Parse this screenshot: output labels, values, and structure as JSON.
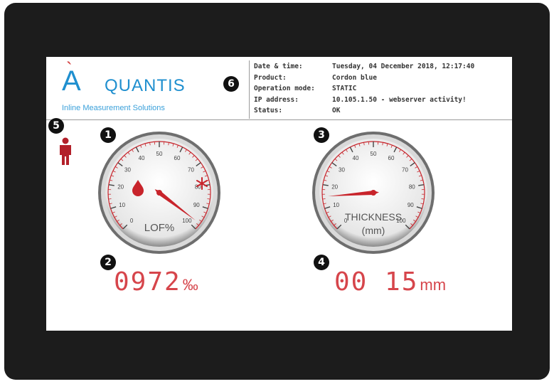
{
  "brand": {
    "logo_text": "AQUANTIS",
    "tagline": "Inline Measurement Solutions",
    "colors": {
      "blue": "#1f8fcf",
      "red": "#d23a3a"
    }
  },
  "info": {
    "rows": [
      {
        "label": "Date & time:",
        "value": "Tuesday, 04 December 2018, 12:17:40"
      },
      {
        "label": "Product:",
        "value": "Cordon blue"
      },
      {
        "label": "Operation mode:",
        "value": "STATIC"
      },
      {
        "label": "IP address:",
        "value": "10.105.1.50 - webserver activity!"
      },
      {
        "label": "Status:",
        "value": "OK"
      }
    ]
  },
  "badges": [
    "1",
    "2",
    "3",
    "4",
    "5",
    "6"
  ],
  "gauge_lof": {
    "label": "LOF%",
    "ticks": [
      "0",
      "10",
      "20",
      "30",
      "40",
      "50",
      "60",
      "70",
      "80",
      "90",
      "100"
    ],
    "value": 97.2,
    "icons": [
      "droplet-icon",
      "snowflake-icon"
    ],
    "accent": "#c8242b"
  },
  "gauge_thickness": {
    "label_line1": "THICKNESS",
    "label_line2": "(mm)",
    "ticks": [
      "0",
      "10",
      "20",
      "30",
      "40",
      "50",
      "60",
      "70",
      "80",
      "90",
      "100"
    ],
    "value": 15,
    "accent": "#c8242b"
  },
  "readout_lof": {
    "digits": "0972",
    "unit": "‰"
  },
  "readout_thickness": {
    "digits": "00 15",
    "unit": "mm"
  },
  "operator_icon": "person-icon"
}
